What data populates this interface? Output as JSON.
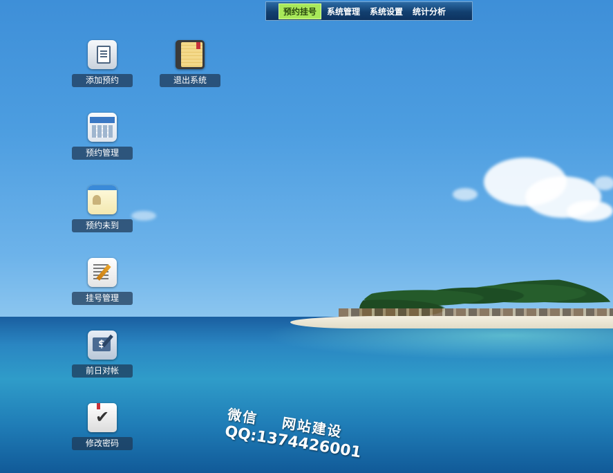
{
  "topbar": {
    "menu": [
      {
        "label": "预约挂号",
        "active": true
      },
      {
        "label": "系统管理",
        "active": false
      },
      {
        "label": "系统设置",
        "active": false
      },
      {
        "label": "统计分析",
        "active": false
      }
    ]
  },
  "desktop": {
    "icons": [
      {
        "label": "添加预约",
        "icon": "document-icon"
      },
      {
        "label": "退出系统",
        "icon": "notebook-icon"
      },
      {
        "label": "预约管理",
        "icon": "calendar-settings-icon"
      },
      {
        "label": "预约未到",
        "icon": "contact-card-settings-icon"
      },
      {
        "label": "挂号管理",
        "icon": "edit-note-icon"
      },
      {
        "label": "前日对帐",
        "icon": "money-ledger-icon"
      },
      {
        "label": "修改密码",
        "icon": "checklist-icon"
      }
    ]
  },
  "watermark": {
    "line1": "微信    网站建设",
    "line2": "QQ:1374426001"
  }
}
